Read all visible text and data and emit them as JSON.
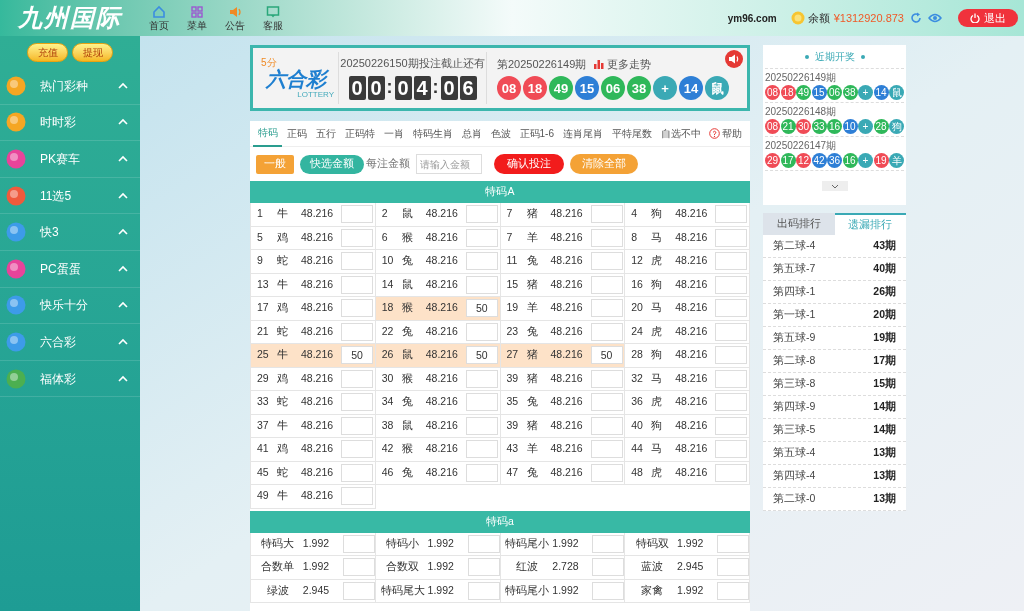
{
  "header": {
    "logo": "九州国际",
    "nav": [
      {
        "label": "首页",
        "kind": "home"
      },
      {
        "label": "菜单",
        "kind": "menu"
      },
      {
        "label": "公告",
        "kind": "notice"
      },
      {
        "label": "客服",
        "kind": "chat"
      }
    ],
    "site": "ym96.com",
    "balance_label": "余额",
    "balance": "¥1312920.873",
    "logout": "退出"
  },
  "sidebar": {
    "buttons": [
      "充值",
      "提现"
    ],
    "items": [
      {
        "label": "热门彩种",
        "color": "#f5a623",
        "expanded": true
      },
      {
        "label": "时时彩",
        "color": "#f5a623",
        "expanded": true
      },
      {
        "label": "PK赛车",
        "color": "#e8439a",
        "expanded": true
      },
      {
        "label": "11选5",
        "color": "#ef5a3c",
        "expanded": true
      },
      {
        "label": "快3",
        "color": "#3d9be9",
        "expanded": true
      },
      {
        "label": "PC蛋蛋",
        "color": "#e8439a",
        "expanded": true
      },
      {
        "label": "快乐十分",
        "color": "#3d9be9",
        "expanded": true
      },
      {
        "label": "六合彩",
        "color": "#3d9be9",
        "expanded": true
      },
      {
        "label": "福体彩",
        "color": "#4caf50",
        "expanded": true
      }
    ]
  },
  "lottery": {
    "logo_small": "5分",
    "logo_name": "六合彩",
    "logo_sub": "LOTTERY",
    "deadline": "20250226150期投注截止还有",
    "countdown": [
      {
        "text": "0",
        "kind": "digit"
      },
      {
        "text": "0",
        "kind": "digit"
      },
      {
        "text": ":",
        "kind": "sep"
      },
      {
        "text": "0",
        "kind": "digit"
      },
      {
        "text": "4",
        "kind": "digit"
      },
      {
        "text": ":",
        "kind": "sep"
      },
      {
        "text": "0",
        "kind": "digit"
      },
      {
        "text": "6",
        "kind": "digit"
      }
    ],
    "last_issue": "第20250226149期",
    "trend": "更多走势",
    "balls": [
      {
        "text": "08",
        "color": "#f04b56"
      },
      {
        "text": "18",
        "color": "#f04b56"
      },
      {
        "text": "49",
        "color": "#2fb85a"
      },
      {
        "text": "15",
        "color": "#2e7fd6"
      },
      {
        "text": "06",
        "color": "#2fb85a"
      },
      {
        "text": "38",
        "color": "#2fb85a"
      },
      {
        "text": "+",
        "color": "#3aa9b5"
      },
      {
        "text": "14",
        "color": "#2e7fd6"
      },
      {
        "text": "鼠",
        "color": "#3aa9b5"
      }
    ]
  },
  "tabs": [
    {
      "label": "特码",
      "selected": true
    },
    {
      "label": "正码",
      "selected": false
    },
    {
      "label": "五行",
      "selected": false
    },
    {
      "label": "正码特",
      "selected": false
    },
    {
      "label": "一肖",
      "selected": false
    },
    {
      "label": "特码生肖",
      "selected": false
    },
    {
      "label": "总肖",
      "selected": false
    },
    {
      "label": "色波",
      "selected": false
    },
    {
      "label": "正码1-6",
      "selected": false
    },
    {
      "label": "连肖尾肖",
      "selected": false
    },
    {
      "label": "平特尾数",
      "selected": false
    },
    {
      "label": "自选不中",
      "selected": false
    }
  ],
  "help": "帮助",
  "toolbar": {
    "mode": "一般",
    "quick": "快选金额",
    "amount_label": "每注金额",
    "amount_placeholder": "请输入金额",
    "confirm": "确认投注",
    "clear": "清除全部"
  },
  "section_a": {
    "title": "特码A",
    "cells": [
      {
        "num": "1",
        "zodiac": "牛",
        "odds": "48.216",
        "selected": false
      },
      {
        "num": "2",
        "zodiac": "鼠",
        "odds": "48.216",
        "selected": false
      },
      {
        "num": "7",
        "zodiac": "猪",
        "odds": "48.216",
        "selected": false
      },
      {
        "num": "4",
        "zodiac": "狗",
        "odds": "48.216",
        "selected": false
      },
      {
        "num": "5",
        "zodiac": "鸡",
        "odds": "48.216",
        "selected": false
      },
      {
        "num": "6",
        "zodiac": "猴",
        "odds": "48.216",
        "selected": false
      },
      {
        "num": "7",
        "zodiac": "羊",
        "odds": "48.216",
        "selected": false
      },
      {
        "num": "8",
        "zodiac": "马",
        "odds": "48.216",
        "selected": false
      },
      {
        "num": "9",
        "zodiac": "蛇",
        "odds": "48.216",
        "selected": false
      },
      {
        "num": "10",
        "zodiac": "兔",
        "odds": "48.216",
        "selected": false
      },
      {
        "num": "11",
        "zodiac": "兔",
        "odds": "48.216",
        "selected": false
      },
      {
        "num": "12",
        "zodiac": "虎",
        "odds": "48.216",
        "selected": false
      },
      {
        "num": "13",
        "zodiac": "牛",
        "odds": "48.216",
        "selected": false
      },
      {
        "num": "14",
        "zodiac": "鼠",
        "odds": "48.216",
        "selected": false
      },
      {
        "num": "15",
        "zodiac": "猪",
        "odds": "48.216",
        "selected": false
      },
      {
        "num": "16",
        "zodiac": "狗",
        "odds": "48.216",
        "selected": false
      },
      {
        "num": "17",
        "zodiac": "鸡",
        "odds": "48.216",
        "selected": false
      },
      {
        "num": "18",
        "zodiac": "猴",
        "odds": "48.216",
        "selected": true,
        "amount": "50"
      },
      {
        "num": "19",
        "zodiac": "羊",
        "odds": "48.216",
        "selected": false
      },
      {
        "num": "20",
        "zodiac": "马",
        "odds": "48.216",
        "selected": false
      },
      {
        "num": "21",
        "zodiac": "蛇",
        "odds": "48.216",
        "selected": false
      },
      {
        "num": "22",
        "zodiac": "兔",
        "odds": "48.216",
        "selected": false
      },
      {
        "num": "23",
        "zodiac": "兔",
        "odds": "48.216",
        "selected": false
      },
      {
        "num": "24",
        "zodiac": "虎",
        "odds": "48.216",
        "selected": false
      },
      {
        "num": "25",
        "zodiac": "牛",
        "odds": "48.216",
        "selected": true,
        "amount": "50"
      },
      {
        "num": "26",
        "zodiac": "鼠",
        "odds": "48.216",
        "selected": true,
        "amount": "50"
      },
      {
        "num": "27",
        "zodiac": "猪",
        "odds": "48.216",
        "selected": true,
        "amount": "50"
      },
      {
        "num": "28",
        "zodiac": "狗",
        "odds": "48.216",
        "selected": false
      },
      {
        "num": "29",
        "zodiac": "鸡",
        "odds": "48.216",
        "selected": false
      },
      {
        "num": "30",
        "zodiac": "猴",
        "odds": "48.216",
        "selected": false
      },
      {
        "num": "39",
        "zodiac": "猪",
        "odds": "48.216",
        "selected": false
      },
      {
        "num": "32",
        "zodiac": "马",
        "odds": "48.216",
        "selected": false
      },
      {
        "num": "33",
        "zodiac": "蛇",
        "odds": "48.216",
        "selected": false
      },
      {
        "num": "34",
        "zodiac": "兔",
        "odds": "48.216",
        "selected": false
      },
      {
        "num": "35",
        "zodiac": "兔",
        "odds": "48.216",
        "selected": false
      },
      {
        "num": "36",
        "zodiac": "虎",
        "odds": "48.216",
        "selected": false
      },
      {
        "num": "37",
        "zodiac": "牛",
        "odds": "48.216",
        "selected": false
      },
      {
        "num": "38",
        "zodiac": "鼠",
        "odds": "48.216",
        "selected": false
      },
      {
        "num": "39",
        "zodiac": "猪",
        "odds": "48.216",
        "selected": false
      },
      {
        "num": "40",
        "zodiac": "狗",
        "odds": "48.216",
        "selected": false
      },
      {
        "num": "41",
        "zodiac": "鸡",
        "odds": "48.216",
        "selected": false
      },
      {
        "num": "42",
        "zodiac": "猴",
        "odds": "48.216",
        "selected": false
      },
      {
        "num": "43",
        "zodiac": "羊",
        "odds": "48.216",
        "selected": false
      },
      {
        "num": "44",
        "zodiac": "马",
        "odds": "48.216",
        "selected": false
      },
      {
        "num": "45",
        "zodiac": "蛇",
        "odds": "48.216",
        "selected": false
      },
      {
        "num": "46",
        "zodiac": "兔",
        "odds": "48.216",
        "selected": false
      },
      {
        "num": "47",
        "zodiac": "兔",
        "odds": "48.216",
        "selected": false
      },
      {
        "num": "48",
        "zodiac": "虎",
        "odds": "48.216",
        "selected": false
      },
      {
        "num": "49",
        "zodiac": "牛",
        "odds": "48.216",
        "selected": false
      }
    ]
  },
  "section_b": {
    "title": "特码a",
    "cells": [
      {
        "label": "特码大",
        "odds": "1.992"
      },
      {
        "label": "特码小",
        "odds": "1.992"
      },
      {
        "label": "特码尾小",
        "odds": "1.992"
      },
      {
        "label": "特码双",
        "odds": "1.992"
      },
      {
        "label": "合数单",
        "odds": "1.992"
      },
      {
        "label": "合数双",
        "odds": "1.992"
      },
      {
        "label": "红波",
        "odds": "2.728"
      },
      {
        "label": "蓝波",
        "odds": "2.945"
      },
      {
        "label": "绿波",
        "odds": "2.945"
      },
      {
        "label": "特码尾大",
        "odds": "1.992"
      },
      {
        "label": "特码尾小",
        "odds": "1.992"
      },
      {
        "label": "家禽",
        "odds": "1.992"
      }
    ]
  },
  "recent": {
    "title": "近期开奖",
    "draws": [
      {
        "issue": "20250226149期",
        "balls": [
          {
            "text": "08",
            "color": "#f04b56"
          },
          {
            "text": "18",
            "color": "#f04b56"
          },
          {
            "text": "49",
            "color": "#2fb85a"
          },
          {
            "text": "15",
            "color": "#2e7fd6"
          },
          {
            "text": "06",
            "color": "#2fb85a"
          },
          {
            "text": "38",
            "color": "#2fb85a"
          },
          {
            "text": "+",
            "color": "#3aa9b5"
          },
          {
            "text": "14",
            "color": "#2e7fd6"
          },
          {
            "text": "鼠",
            "color": "#3aa9b5"
          }
        ]
      },
      {
        "issue": "20250226148期",
        "balls": [
          {
            "text": "08",
            "color": "#f04b56"
          },
          {
            "text": "21",
            "color": "#2fb85a"
          },
          {
            "text": "30",
            "color": "#f04b56"
          },
          {
            "text": "33",
            "color": "#2fb85a"
          },
          {
            "text": "16",
            "color": "#2fb85a"
          },
          {
            "text": "10",
            "color": "#2e7fd6"
          },
          {
            "text": "+",
            "color": "#3aa9b5"
          },
          {
            "text": "28",
            "color": "#2fb85a"
          },
          {
            "text": "狗",
            "color": "#3aa9b5"
          }
        ]
      },
      {
        "issue": "20250226147期",
        "balls": [
          {
            "text": "29",
            "color": "#f04b56"
          },
          {
            "text": "17",
            "color": "#2fb85a"
          },
          {
            "text": "12",
            "color": "#f04b56"
          },
          {
            "text": "42",
            "color": "#2e7fd6"
          },
          {
            "text": "36",
            "color": "#2e7fd6"
          },
          {
            "text": "16",
            "color": "#2fb85a"
          },
          {
            "text": "+",
            "color": "#3aa9b5"
          },
          {
            "text": "19",
            "color": "#f04b56"
          },
          {
            "text": "羊",
            "color": "#3aa9b5"
          }
        ]
      }
    ]
  },
  "ranking": {
    "tabs": [
      {
        "label": "出码排行",
        "selected": false
      },
      {
        "label": "遗漏排行",
        "selected": true
      }
    ],
    "rows": [
      {
        "name": "第二球-4",
        "count": "43期"
      },
      {
        "name": "第五球-7",
        "count": "40期"
      },
      {
        "name": "第四球-1",
        "count": "26期"
      },
      {
        "name": "第一球-1",
        "count": "20期"
      },
      {
        "name": "第五球-9",
        "count": "19期"
      },
      {
        "name": "第二球-8",
        "count": "17期"
      },
      {
        "name": "第三球-8",
        "count": "15期"
      },
      {
        "name": "第四球-9",
        "count": "14期"
      },
      {
        "name": "第三球-5",
        "count": "14期"
      },
      {
        "name": "第五球-4",
        "count": "13期"
      },
      {
        "name": "第四球-4",
        "count": "13期"
      },
      {
        "name": "第二球-0",
        "count": "13期"
      }
    ]
  }
}
